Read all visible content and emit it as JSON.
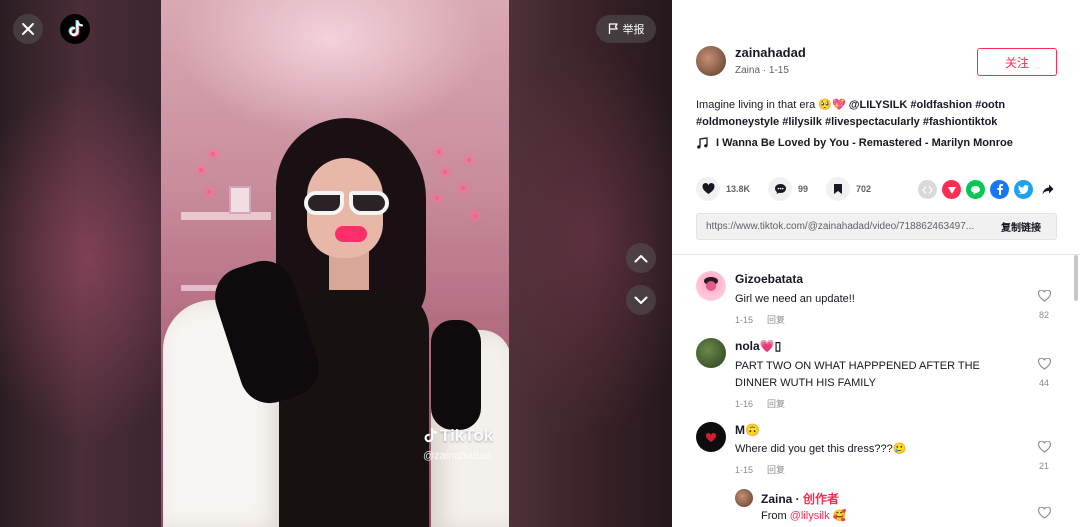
{
  "top": {
    "report_label": "举报"
  },
  "video": {
    "watermark_brand": "TikTok",
    "watermark_user": "@zainahadad"
  },
  "author": {
    "name": "zainahadad",
    "meta": "Zaina · 1-15",
    "follow_label": "关注"
  },
  "post": {
    "desc_text": "Imagine living in that era 🥺💖 ",
    "desc_mention": "@LILYSILK",
    "desc_tags": " #oldfashion #ootn #oldmoneystyle #lilysilk #livespectacularly #fashiontiktok",
    "music": "I Wanna Be Loved by You - Remastered - Marilyn Monroe",
    "likes": "13.8K",
    "comments": "99",
    "saves": "702",
    "link": "https://www.tiktok.com/@zainahadad/video/718862463497...",
    "copy_label": "复制链接"
  },
  "share_icons": [
    "embed-icon",
    "red-share-icon",
    "line-icon",
    "facebook-icon",
    "twitter-icon",
    "forward-icon"
  ],
  "colors": {
    "accent": "#fe2c55",
    "facebook": "#1877f2",
    "twitter": "#1da1f2",
    "line": "#06c755"
  },
  "comments": [
    {
      "name": "Gizoebatata",
      "text": "Girl we need an update!!",
      "date": "1-15",
      "reply": "回复",
      "likes": "82"
    },
    {
      "name": "nola💗▯",
      "text": "PART TWO ON WHAT HAPPPENED AFTER THE DINNER WUTH HIS FAMILY",
      "date": "1-16",
      "reply": "回复",
      "likes": "44"
    },
    {
      "name": "M🙃",
      "text": "Where did you get this dress???🥲",
      "date": "1-15",
      "reply": "回复",
      "likes": "21"
    }
  ],
  "reply": {
    "name": "Zaina",
    "sep": " · ",
    "badge": "创作者",
    "text_prefix": "From ",
    "mention": "@lilysilk",
    "emoji": " 🥰"
  }
}
